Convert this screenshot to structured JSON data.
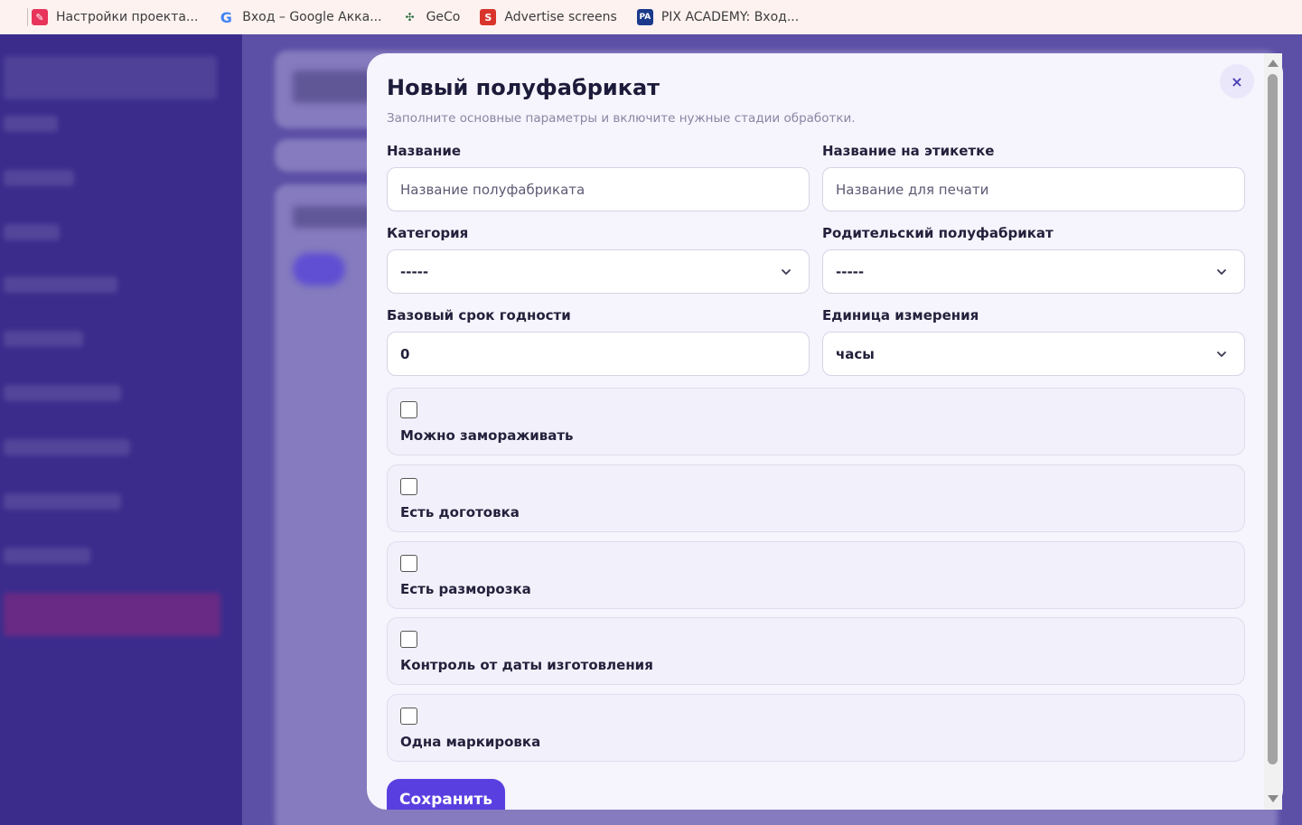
{
  "bookmarks": [
    {
      "label": "Настройки проекта...",
      "icon": "project-settings-icon",
      "color": "#e8345a"
    },
    {
      "label": "Вход – Google Акка...",
      "icon": "google-icon",
      "color": "#4285f4"
    },
    {
      "label": "GeCo",
      "icon": "geco-icon",
      "color": "#2c6e3f"
    },
    {
      "label": "Advertise screens",
      "icon": "advertise-icon",
      "color": "#d9342b"
    },
    {
      "label": "PIX ACADEMY: Вход...",
      "icon": "pix-academy-icon",
      "color": "#1b3a8c"
    }
  ],
  "modal": {
    "title": "Новый полуфабрикат",
    "subtitle": "Заполните основные параметры и включите нужные стадии обработки.",
    "close_icon": "×",
    "fields": {
      "name_label": "Название",
      "name_placeholder": "Название полуфабриката",
      "label_name_label": "Название на этикетке",
      "label_name_placeholder": "Название для печати",
      "category_label": "Категория",
      "category_value": "-----",
      "parent_label": "Родительский полуфабрикат",
      "parent_value": "-----",
      "shelf_life_label": "Базовый срок годности",
      "shelf_life_value": "0",
      "unit_label": "Единица измерения",
      "unit_value": "часы"
    },
    "checkboxes": [
      {
        "label": "Можно замораживать",
        "checked": false
      },
      {
        "label": "Есть доготовка",
        "checked": false
      },
      {
        "label": "Есть разморозка",
        "checked": false
      },
      {
        "label": "Контроль от даты изготовления",
        "checked": false
      },
      {
        "label": "Одна маркировка",
        "checked": false
      }
    ],
    "save_label": "Сохранить"
  },
  "colors": {
    "accent": "#5a3fe0",
    "sidebar": "#3b2c8c",
    "modal_bg": "#f6f4fc"
  }
}
